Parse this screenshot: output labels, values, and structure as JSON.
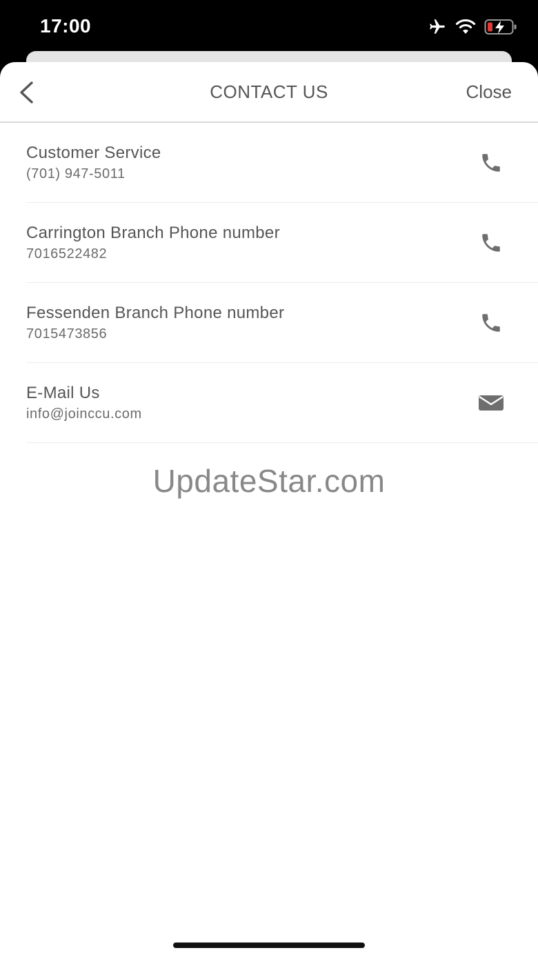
{
  "status_bar": {
    "time": "17:00",
    "icons": [
      "airplane-icon",
      "wifi-icon",
      "battery-charging-icon"
    ],
    "battery_color": "#e53935"
  },
  "nav": {
    "title": "CONTACT US",
    "close_label": "Close",
    "back_icon": "chevron-left-icon"
  },
  "contacts": [
    {
      "title": "Customer Service",
      "detail": "(701) 947-5011",
      "icon": "phone-icon"
    },
    {
      "title": "Carrington Branch Phone number",
      "detail": "7016522482",
      "icon": "phone-icon"
    },
    {
      "title": "Fessenden Branch Phone number",
      "detail": "7015473856",
      "icon": "phone-icon"
    },
    {
      "title": "E-Mail Us",
      "detail": "info@joinccu.com",
      "icon": "mail-icon"
    }
  ],
  "watermark": "UpdateStar.com",
  "colors": {
    "text": "#555555",
    "icon": "#6e6e6e",
    "divider": "#ececec"
  }
}
